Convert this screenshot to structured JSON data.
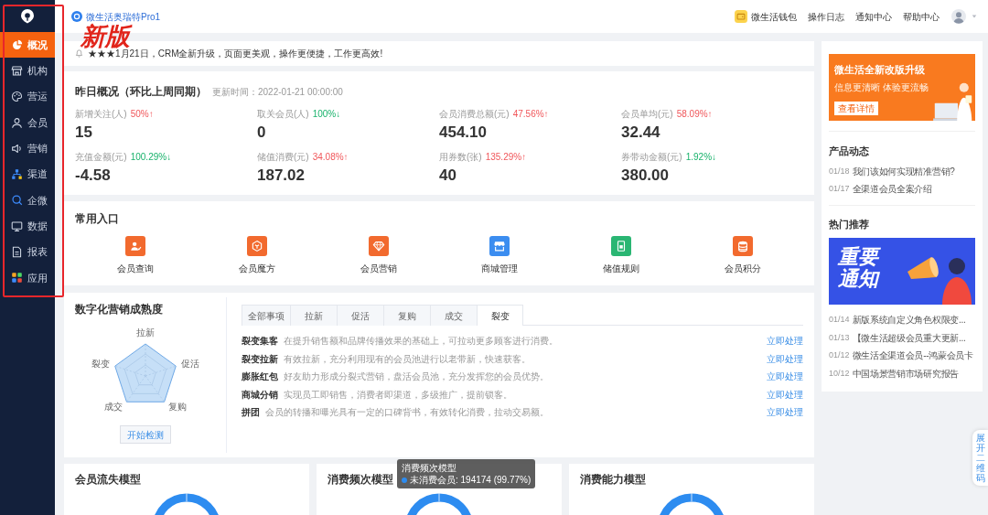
{
  "sidebar": {
    "items": [
      {
        "label": "概况",
        "selected": true
      },
      {
        "label": "机构",
        "selected": false
      },
      {
        "label": "营运",
        "selected": false
      },
      {
        "label": "会员",
        "selected": false
      },
      {
        "label": "营销",
        "selected": false
      },
      {
        "label": "渠道",
        "selected": false
      },
      {
        "label": "企微",
        "selected": false
      },
      {
        "label": "数据",
        "selected": false
      },
      {
        "label": "报表",
        "selected": false
      },
      {
        "label": "应用",
        "selected": false
      }
    ]
  },
  "annotation": {
    "label": "新版"
  },
  "top_bar": {
    "brand": "微生活奥瑞特Pro1",
    "links": [
      {
        "label": "微生活钱包",
        "kind": "wallet"
      },
      {
        "label": "操作日志",
        "kind": "plain"
      },
      {
        "label": "通知中心",
        "kind": "plain"
      },
      {
        "label": "帮助中心",
        "kind": "plain"
      }
    ]
  },
  "notice": {
    "text": "★★★1月21日，CRM全新升级，页面更美观，操作更便捷，工作更高效!"
  },
  "overview": {
    "title": "昨日概况（环比上周同期）",
    "updated": "更新时间：2022-01-21 00:00:00",
    "metrics": [
      {
        "label": "新增关注(人)",
        "change": "50%↑",
        "increase": true,
        "value": "15"
      },
      {
        "label": "取关会员(人)",
        "change": "100%↓",
        "increase": false,
        "value": "0"
      },
      {
        "label": "会员消费总额(元)",
        "change": "47.56%↑",
        "increase": true,
        "value": "454.10"
      },
      {
        "label": "会员单均(元)",
        "change": "58.09%↑",
        "increase": true,
        "value": "32.44"
      },
      {
        "label": "充值金额(元)",
        "change": "100.29%↓",
        "increase": false,
        "value": "-4.58"
      },
      {
        "label": "储值消费(元)",
        "change": "34.08%↑",
        "increase": true,
        "value": "187.02"
      },
      {
        "label": "用券数(张)",
        "change": "135.29%↑",
        "increase": true,
        "value": "40"
      },
      {
        "label": "券带动金额(元)",
        "change": "1.92%↓",
        "increase": false,
        "value": "380.00"
      }
    ]
  },
  "shortcuts": {
    "title": "常用入口",
    "items": [
      {
        "label": "会员查询",
        "color": "#f26a2e"
      },
      {
        "label": "会员魔方",
        "color": "#f26a2e"
      },
      {
        "label": "会员营销",
        "color": "#f26a2e"
      },
      {
        "label": "商城管理",
        "color": "#3b8df0"
      },
      {
        "label": "储值规则",
        "color": "#2ab673"
      },
      {
        "label": "会员积分",
        "color": "#f26a2e"
      }
    ]
  },
  "maturity": {
    "title": "数字化营销成熟度",
    "radar_labels": [
      "拉新",
      "促活",
      "复购",
      "成交",
      "裂变"
    ],
    "button": "开始检测",
    "tabs": [
      {
        "label": "全部事项",
        "selected": false
      },
      {
        "label": "拉新",
        "selected": false
      },
      {
        "label": "促活",
        "selected": false
      },
      {
        "label": "复购",
        "selected": false
      },
      {
        "label": "成交",
        "selected": false
      },
      {
        "label": "裂变",
        "selected": true
      }
    ],
    "tasks": [
      {
        "name": "裂变集客",
        "description": "在提升销售额和品牌传播效果的基础上，可拉动更多顾客进行消费。",
        "action": "立即处理"
      },
      {
        "name": "裂变拉新",
        "description": "有效拉新，充分利用现有的会员池进行以老带新，快速获客。",
        "action": "立即处理"
      },
      {
        "name": "膨胀红包",
        "description": "好友助力形成分裂式营销，盘活会员池，充分发挥您的会员优势。",
        "action": "立即处理"
      },
      {
        "name": "商城分销",
        "description": "实现员工即销售，消费者即渠道，多级推广，提前锁客。",
        "action": "立即处理"
      },
      {
        "name": "拼团",
        "description": "会员的转播和曝光具有一定的口碑背书，有效转化消费，拉动交易额。",
        "action": "立即处理"
      }
    ]
  },
  "models": [
    {
      "title": "会员流失模型"
    },
    {
      "title": "消费频次模型"
    },
    {
      "title": "消费能力模型"
    }
  ],
  "tooltip": {
    "title": "消费频次模型",
    "text": "未消费会员: 194174 (99.77%)"
  },
  "right_panel": {
    "promo": {
      "title": "微生活全新改版升级",
      "subtitle": "信息更清晰 体验更流畅",
      "button": "查看详情"
    },
    "news": {
      "title": "产品动态",
      "items": [
        {
          "date": "01/18",
          "title": "我们该如何实现精准营销?"
        },
        {
          "date": "01/17",
          "title": "全渠道会员全案介绍"
        }
      ]
    },
    "recommend": {
      "title": "热门推荐",
      "banner": {
        "title": "重要通知"
      },
      "items": [
        {
          "date": "01/14",
          "title": "新版系统自定义角色权限变..."
        },
        {
          "date": "01/13",
          "title": "【微生活超级会员重大更新..."
        },
        {
          "date": "01/12",
          "title": "微生活全渠道会员--鸿蒙会员卡"
        },
        {
          "date": "10/12",
          "title": "中国场景营销市场研究报告"
        }
      ]
    }
  },
  "qr_toggle": {
    "label": "展开二维码"
  }
}
